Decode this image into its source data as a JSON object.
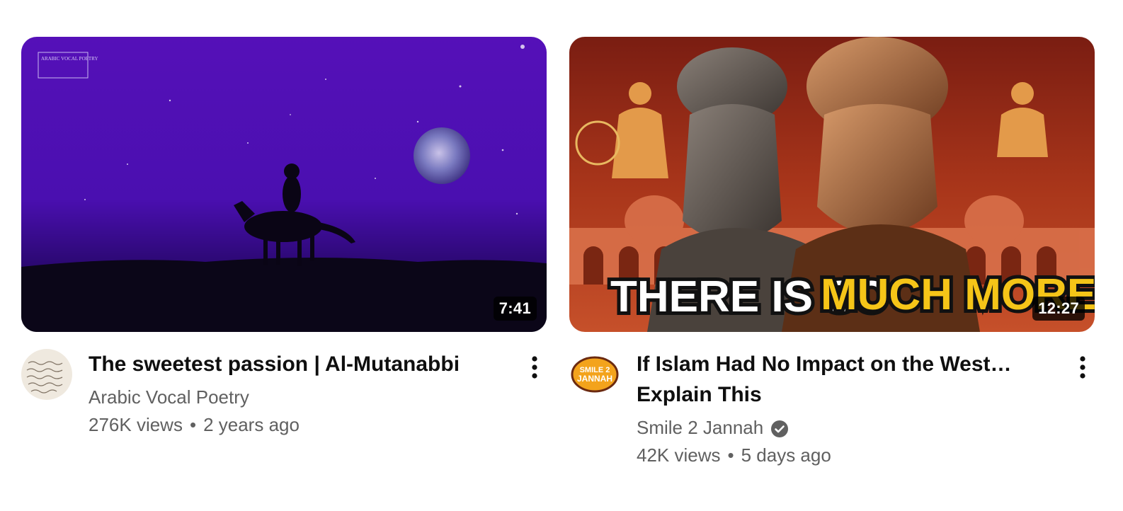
{
  "videos": [
    {
      "title": "The sweetest passion | Al-Mutanabbi",
      "channel": "Arabic Vocal Poetry",
      "verified": false,
      "views": "276K views",
      "age": "2 years ago",
      "duration": "7:41",
      "thumbnail_logo": "ARABIC VOCAL POETRY",
      "avatar_icon": "calligraphy-avatar-icon"
    },
    {
      "title": "If Islam Had No Impact on the West… Explain This",
      "channel": "Smile 2 Jannah",
      "verified": true,
      "views": "42K views",
      "age": "5 days ago",
      "duration": "12:27",
      "thumbnail_text_white": "THERE IS SO",
      "thumbnail_text_yellow": "MUCH MORE!",
      "avatar_text": "SMILE 2 JANNAH",
      "avatar_icon": "smile2jannah-logo-icon"
    }
  ],
  "separator": "•",
  "colors": {
    "title": "#0f0f0f",
    "secondary": "#606060",
    "thumb1_sky": "#4a0fb0",
    "thumb2_bg": "#a8351a",
    "thumb2_yellow": "#f5c518"
  }
}
